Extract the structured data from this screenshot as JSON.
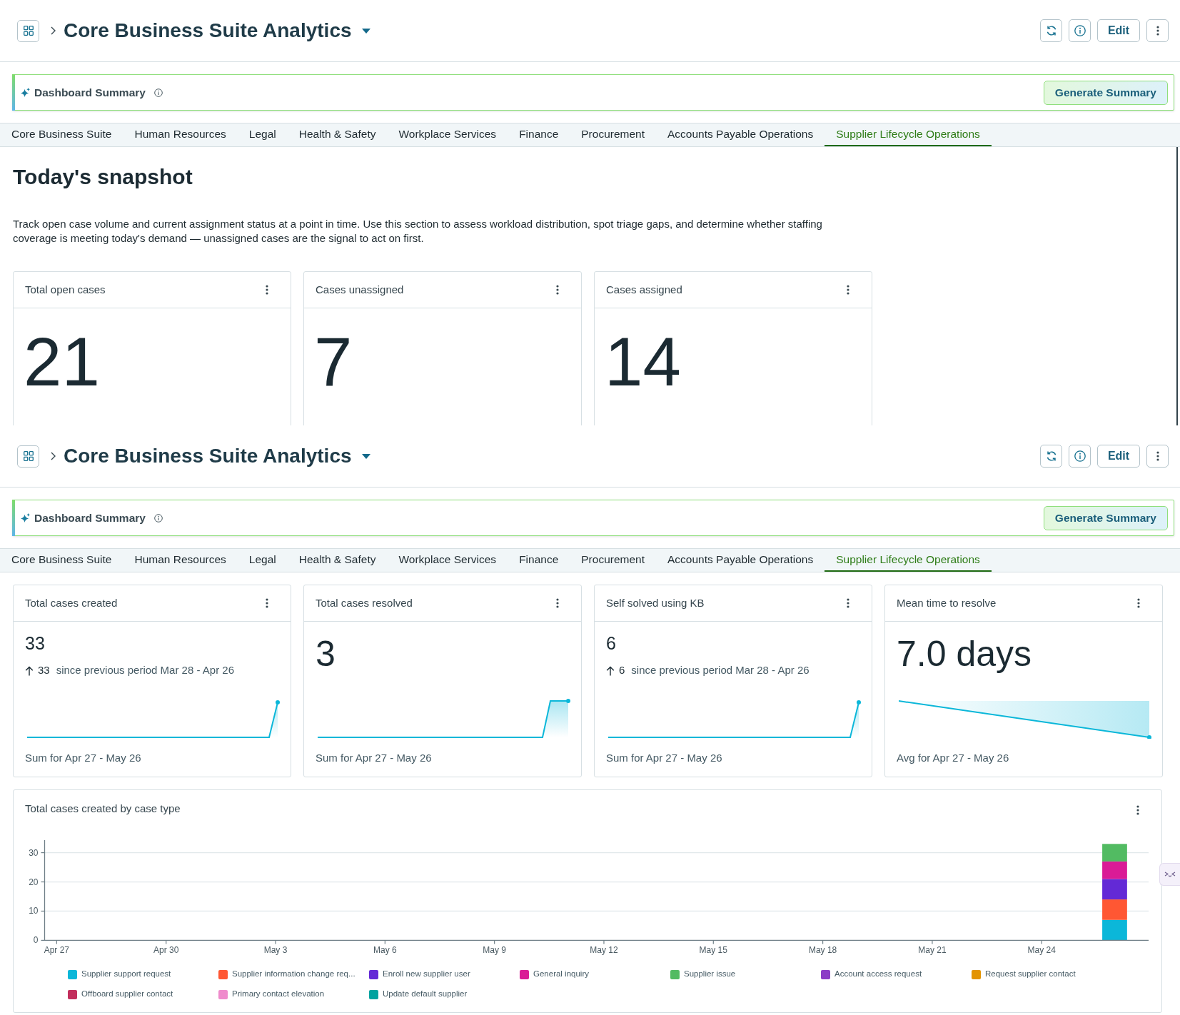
{
  "views": [
    {
      "header": {
        "title": "Core Business Suite Analytics",
        "edit_button": "Edit"
      },
      "summary": {
        "title": "Dashboard Summary",
        "button": "Generate Summary"
      },
      "tabs": [
        {
          "label": "Core Business Suite",
          "selected": false
        },
        {
          "label": "Human Resources",
          "selected": false
        },
        {
          "label": "Legal",
          "selected": false
        },
        {
          "label": "Health & Safety",
          "selected": false
        },
        {
          "label": "Workplace Services",
          "selected": false
        },
        {
          "label": "Finance",
          "selected": false
        },
        {
          "label": "Procurement",
          "selected": false
        },
        {
          "label": "Accounts Payable Operations",
          "selected": false
        },
        {
          "label": "Supplier Lifecycle Operations",
          "selected": true
        }
      ],
      "section": {
        "heading": "Today's snapshot",
        "description": "Track open case volume and current assignment status at a point in time. Use this section to assess workload distribution, spot triage gaps, and determine whether staffing coverage is meeting today's demand — unassigned cases are the signal to act on first.",
        "cards": [
          {
            "title": "Total open cases",
            "value": "21"
          },
          {
            "title": "Cases unassigned",
            "value": "7"
          },
          {
            "title": "Cases assigned",
            "value": "14"
          }
        ]
      }
    },
    {
      "header": {
        "title": "Core Business Suite Analytics",
        "edit_button": "Edit"
      },
      "summary": {
        "title": "Dashboard Summary",
        "button": "Generate Summary"
      },
      "tabs": [
        {
          "label": "Core Business Suite",
          "selected": false
        },
        {
          "label": "Human Resources",
          "selected": false
        },
        {
          "label": "Legal",
          "selected": false
        },
        {
          "label": "Health & Safety",
          "selected": false
        },
        {
          "label": "Workplace Services",
          "selected": false
        },
        {
          "label": "Finance",
          "selected": false
        },
        {
          "label": "Procurement",
          "selected": false
        },
        {
          "label": "Accounts Payable Operations",
          "selected": false
        },
        {
          "label": "Supplier Lifecycle Operations",
          "selected": true
        }
      ],
      "cards": [
        {
          "kind": "trend",
          "title": "Total cases created",
          "value": "33",
          "change": {
            "amount": "33",
            "text": "since previous period Mar 28 - Apr 26"
          },
          "footnote": "Sum for Apr 27 - May 26"
        },
        {
          "kind": "total",
          "title": "Total cases resolved",
          "value": "3",
          "footnote": "Sum for Apr 27 - May 26"
        },
        {
          "kind": "trend",
          "title": "Self solved using KB",
          "value": "6",
          "change": {
            "amount": "6",
            "text": "since previous period Mar 28 - Apr 26"
          },
          "footnote": "Sum for Apr 27 - May 26"
        },
        {
          "kind": "average",
          "title": "Mean time to resolve",
          "value": "7.0 days",
          "footnote": "Avg for Apr 27 - May 26"
        }
      ],
      "chart_card": {
        "chart_data": {
          "type": "bar",
          "title": "Total cases created by case type",
          "categories": [
            "Apr 27",
            null,
            null,
            "Apr 30",
            null,
            null,
            "May 3",
            null,
            null,
            "May 6",
            null,
            null,
            "May 9",
            null,
            null,
            "May 12",
            null,
            null,
            "May 15",
            null,
            null,
            "May 18",
            null,
            null,
            "May 21",
            null,
            null,
            "May 24",
            null,
            null
          ],
          "series": [
            {
              "name": "Supplier support request",
              "color": "#0bb7d9",
              "values": [
                null,
                null,
                null,
                null,
                null,
                null,
                null,
                null,
                null,
                null,
                null,
                null,
                null,
                null,
                null,
                null,
                null,
                null,
                null,
                null,
                null,
                null,
                null,
                null,
                null,
                null,
                null,
                null,
                null,
                7
              ]
            },
            {
              "name": "Supplier information change req...",
              "color": "#ff5733",
              "values": [
                null,
                null,
                null,
                null,
                null,
                null,
                null,
                null,
                null,
                null,
                null,
                null,
                null,
                null,
                null,
                null,
                null,
                null,
                null,
                null,
                null,
                null,
                null,
                null,
                null,
                null,
                null,
                null,
                null,
                7
              ]
            },
            {
              "name": "Enroll new supplier user",
              "color": "#6329d6",
              "values": [
                null,
                null,
                null,
                null,
                null,
                null,
                null,
                null,
                null,
                null,
                null,
                null,
                null,
                null,
                null,
                null,
                null,
                null,
                null,
                null,
                null,
                null,
                null,
                null,
                null,
                null,
                null,
                null,
                null,
                7
              ]
            },
            {
              "name": "General inquiry",
              "color": "#da1b96",
              "values": [
                null,
                null,
                null,
                null,
                null,
                null,
                null,
                null,
                null,
                null,
                null,
                null,
                null,
                null,
                null,
                null,
                null,
                null,
                null,
                null,
                null,
                null,
                null,
                null,
                null,
                null,
                null,
                null,
                null,
                6
              ]
            },
            {
              "name": "Supplier issue",
              "color": "#52bb62",
              "values": [
                null,
                null,
                null,
                null,
                null,
                null,
                null,
                null,
                null,
                null,
                null,
                null,
                null,
                null,
                null,
                null,
                null,
                null,
                null,
                null,
                null,
                null,
                null,
                null,
                null,
                null,
                null,
                null,
                null,
                6
              ]
            },
            {
              "name": "Account access request",
              "color": "#8b3bc6",
              "values": [
                null,
                null,
                null,
                null,
                null,
                null,
                null,
                null,
                null,
                null,
                null,
                null,
                null,
                null,
                null,
                null,
                null,
                null,
                null,
                null,
                null,
                null,
                null,
                null,
                null,
                null,
                null,
                null,
                null,
                0
              ]
            },
            {
              "name": "Request supplier contact",
              "color": "#e39300",
              "values": [
                null,
                null,
                null,
                null,
                null,
                null,
                null,
                null,
                null,
                null,
                null,
                null,
                null,
                null,
                null,
                null,
                null,
                null,
                null,
                null,
                null,
                null,
                null,
                null,
                null,
                null,
                null,
                null,
                null,
                0
              ]
            },
            {
              "name": "Offboard supplier contact",
              "color": "#c22e5c",
              "values": [
                null,
                null,
                null,
                null,
                null,
                null,
                null,
                null,
                null,
                null,
                null,
                null,
                null,
                null,
                null,
                null,
                null,
                null,
                null,
                null,
                null,
                null,
                null,
                null,
                null,
                null,
                null,
                null,
                null,
                0
              ]
            },
            {
              "name": "Primary contact elevation",
              "color": "#ef8bcc",
              "values": [
                null,
                null,
                null,
                null,
                null,
                null,
                null,
                null,
                null,
                null,
                null,
                null,
                null,
                null,
                null,
                null,
                null,
                null,
                null,
                null,
                null,
                null,
                null,
                null,
                null,
                null,
                null,
                null,
                null,
                0
              ]
            },
            {
              "name": "Update default supplier",
              "color": "#00a3a0",
              "values": [
                null,
                null,
                null,
                null,
                null,
                null,
                null,
                null,
                null,
                null,
                null,
                null,
                null,
                null,
                null,
                null,
                null,
                null,
                null,
                null,
                null,
                null,
                null,
                null,
                null,
                null,
                null,
                null,
                null,
                0
              ]
            }
          ],
          "stacked": true,
          "ylim": [
            0,
            34.3
          ],
          "yticks": [
            0,
            10,
            20,
            30
          ],
          "grid": true,
          "legend": "bottom"
        }
      }
    }
  ]
}
